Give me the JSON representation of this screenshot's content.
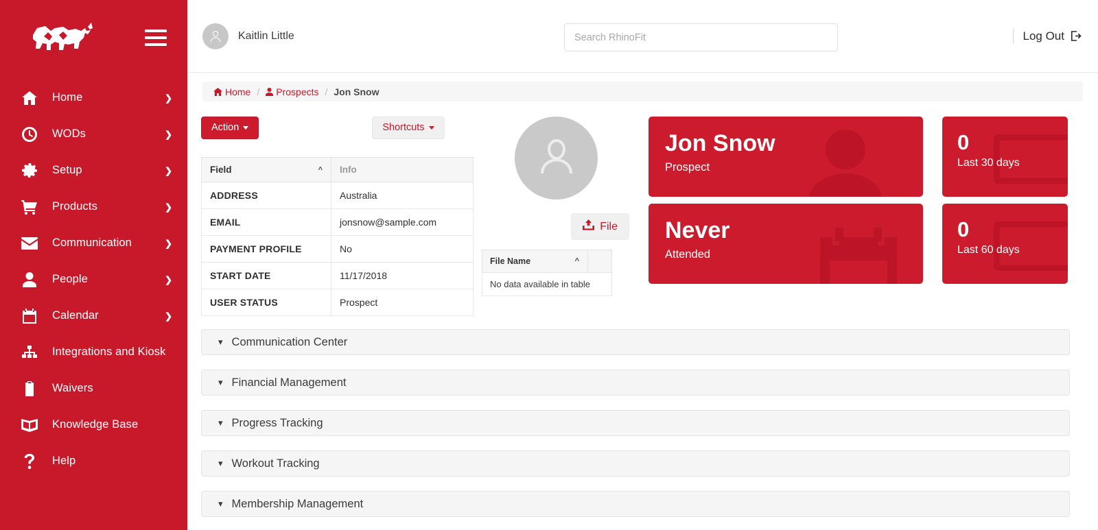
{
  "brand": {
    "name": "RhinoFit",
    "sidebar_color": "#c8192b",
    "card_color": "#cc1b2c",
    "accent_color": "#c8192b",
    "logo_icon": "rhino-logo-icon"
  },
  "sidebar": {
    "menu_toggle_icon": "hamburger-icon",
    "items": [
      {
        "label": "Home",
        "icon": "home-icon",
        "has_caret": true
      },
      {
        "label": "WODs",
        "icon": "clock-icon",
        "has_caret": true
      },
      {
        "label": "Setup",
        "icon": "gear-icon",
        "has_caret": true
      },
      {
        "label": "Products",
        "icon": "cart-icon",
        "has_caret": true
      },
      {
        "label": "Communication",
        "icon": "envelope-icon",
        "has_caret": true
      },
      {
        "label": "People",
        "icon": "person-icon",
        "has_caret": true
      },
      {
        "label": "Calendar",
        "icon": "calendar-icon",
        "has_caret": true
      },
      {
        "label": "Integrations and Kiosk",
        "icon": "sitemap-icon",
        "has_caret": false
      },
      {
        "label": "Waivers",
        "icon": "clipboard-icon",
        "has_caret": false
      },
      {
        "label": "Knowledge Base",
        "icon": "book-icon",
        "has_caret": false
      },
      {
        "label": "Help",
        "icon": "question-mark-icon",
        "has_caret": false
      }
    ]
  },
  "topbar": {
    "user_name": "Kaitlin Little",
    "avatar_icon": "user-avatar-icon",
    "search_placeholder": "Search RhinoFit",
    "search_value": "",
    "logout_label": "Log Out",
    "logout_icon": "logout-icon"
  },
  "breadcrumb": {
    "home_label": "Home",
    "home_icon": "home-icon",
    "prospects_label": "Prospects",
    "prospects_icon": "person-icon",
    "separator": "/",
    "current_label": "Jon Snow"
  },
  "toolbar": {
    "action_label": "Action",
    "shortcuts_label": "Shortcuts"
  },
  "info_table": {
    "headers": {
      "field": "Field",
      "info": "Info"
    },
    "sort_indicator": "▲",
    "rows": [
      {
        "field": "ADDRESS",
        "info": "Australia"
      },
      {
        "field": "EMAIL",
        "info": "jonsnow@sample.com"
      },
      {
        "field": "PAYMENT PROFILE",
        "info": "No"
      },
      {
        "field": "START DATE",
        "info": "11/17/2018"
      },
      {
        "field": "USER STATUS",
        "info": "Prospect"
      }
    ]
  },
  "profile": {
    "avatar_icon": "user-avatar-icon",
    "file_button_label": "File",
    "file_button_icon": "upload-icon"
  },
  "file_table": {
    "header": "File Name",
    "sort_indicator": "▲",
    "empty_message": "No data available in table"
  },
  "cards": {
    "primary": [
      {
        "value": "Jon Snow",
        "label": "Prospect",
        "bg_icon": "person-silhouette-icon"
      },
      {
        "value": "Never",
        "label": "Attended",
        "bg_icon": "calendar-icon"
      }
    ],
    "secondary": [
      {
        "value": "0",
        "label": "Last 30 days",
        "bg_icon": "card-outline-icon"
      },
      {
        "value": "0",
        "label": "Last 60 days",
        "bg_icon": "card-outline-icon"
      }
    ]
  },
  "accordions": [
    {
      "label": "Communication Center",
      "chevron": "chevron-down-icon",
      "expanded": false
    },
    {
      "label": "Financial Management",
      "chevron": "chevron-down-icon",
      "expanded": false
    },
    {
      "label": "Progress Tracking",
      "chevron": "chevron-down-icon",
      "expanded": false
    },
    {
      "label": "Workout Tracking",
      "chevron": "chevron-down-icon",
      "expanded": false
    },
    {
      "label": "Membership Management",
      "chevron": "chevron-down-icon",
      "expanded": false
    }
  ]
}
